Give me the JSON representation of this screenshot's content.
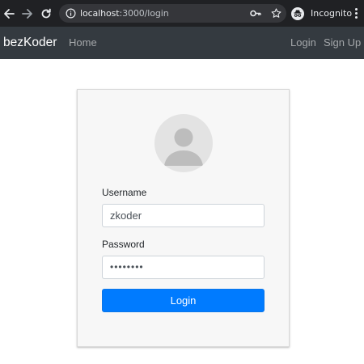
{
  "browser": {
    "url_host": "localhost",
    "url_path": ":3000/login",
    "incognito_label": "Incognito",
    "icons": [
      "back-arrow-icon",
      "forward-arrow-icon",
      "reload-icon",
      "info-icon",
      "key-icon",
      "star-icon",
      "incognito-icon",
      "kebab-menu-icon"
    ],
    "colors": {
      "chrome_bg": "#202124",
      "omnibox_bg": "#35363a"
    }
  },
  "navbar": {
    "brand": "bezKoder",
    "home": "Home",
    "login": "Login",
    "signup": "Sign Up",
    "colors": {
      "bg": "#343a40"
    }
  },
  "form": {
    "avatar_icon": "user-avatar-icon",
    "username_label": "Username",
    "username_value": "zkoder",
    "password_label": "Password",
    "password_value": "••••••••",
    "submit_label": "Login",
    "colors": {
      "primary": "#007bff",
      "card_bg": "#f7f7f7"
    }
  }
}
